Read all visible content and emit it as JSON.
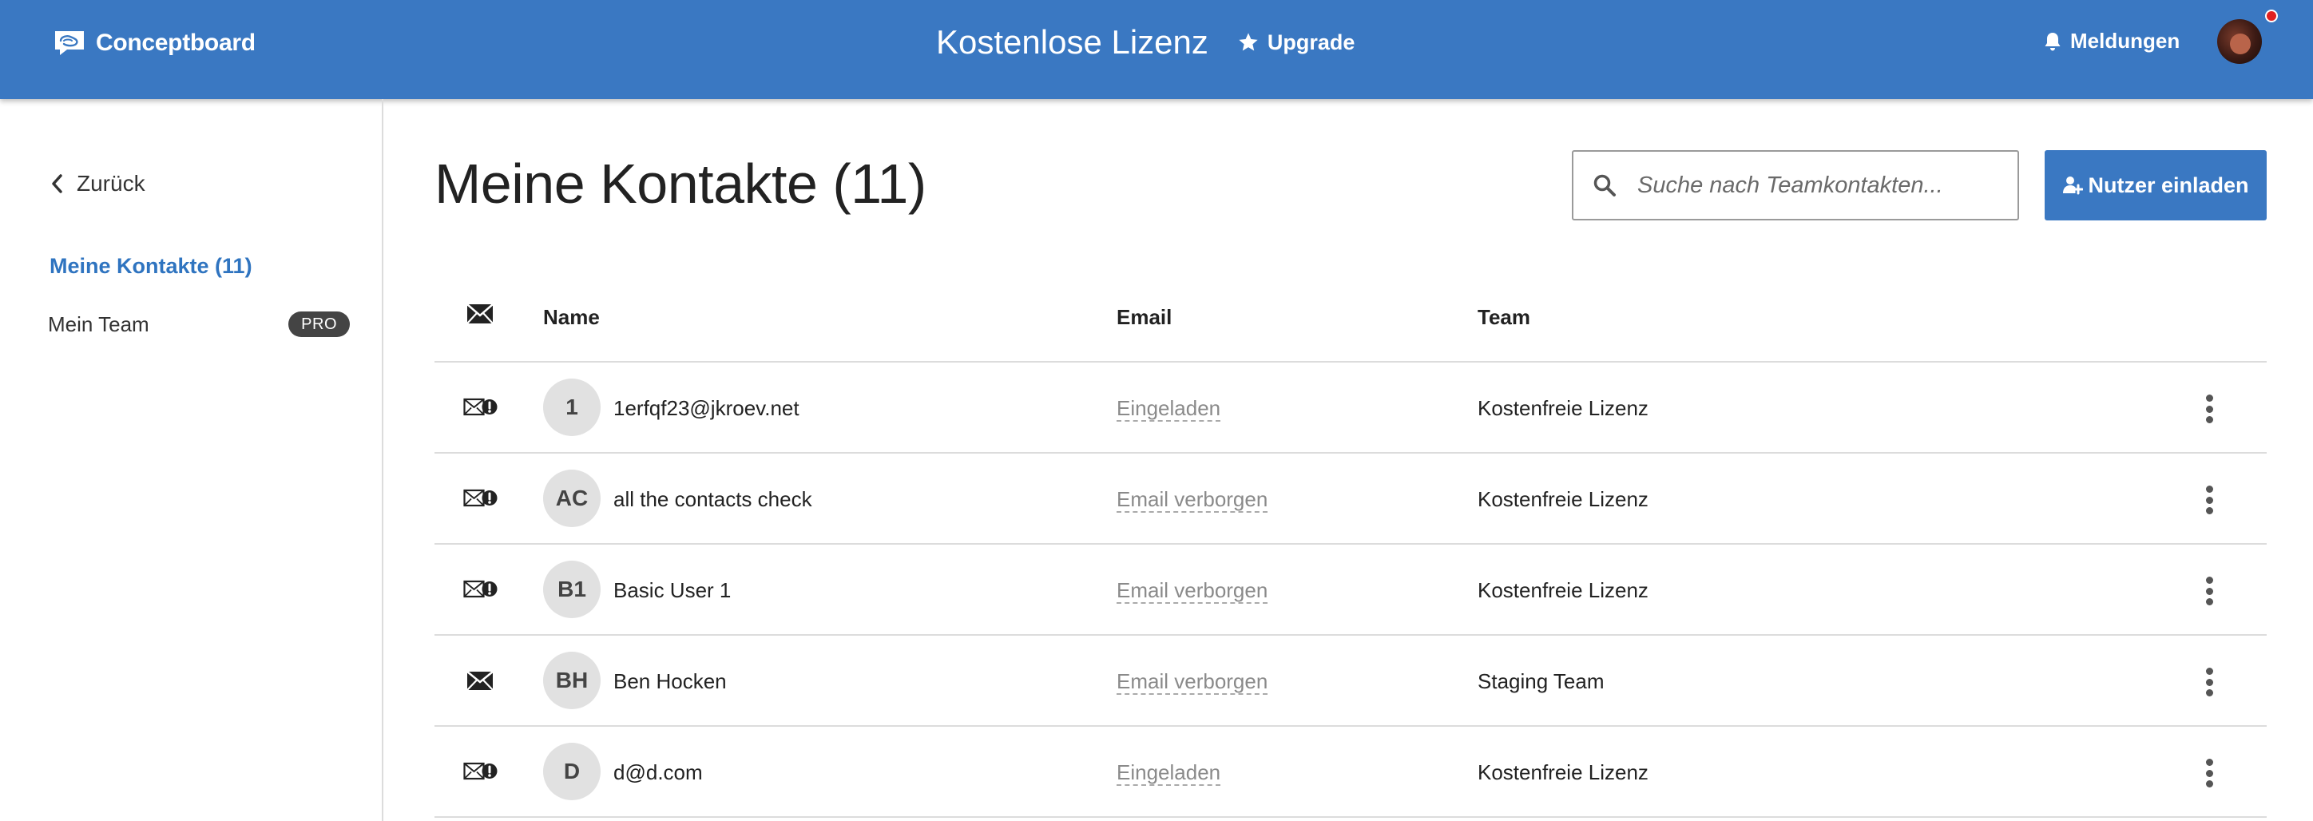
{
  "header": {
    "logo_text": "Conceptboard",
    "license_title": "Kostenlose Lizenz",
    "upgrade_label": "Upgrade",
    "notifications_label": "Meldungen",
    "accent_color": "#3a78c2"
  },
  "sidebar": {
    "back_label": "Zurück",
    "active_label": "Meine Kontakte (11)",
    "items": [
      {
        "label": "Mein Team",
        "badge": "PRO"
      }
    ]
  },
  "main": {
    "title": "Meine Kontakte (11)",
    "search": {
      "placeholder": "Suche nach Teamkontakten..."
    },
    "invite_label": "Nutzer einladen"
  },
  "table": {
    "headers": {
      "name": "Name",
      "email": "Email",
      "team": "Team"
    },
    "rows": [
      {
        "initials": "1",
        "name": "1erfqf23@jkroev.net",
        "email": "Eingeladen",
        "team": "Kostenfreie Lizenz",
        "mail_icon": "mail-alert-icon"
      },
      {
        "initials": "AC",
        "name": "all the contacts check",
        "email": "Email verborgen",
        "team": "Kostenfreie Lizenz",
        "mail_icon": "mail-alert-icon"
      },
      {
        "initials": "B1",
        "name": "Basic User 1",
        "email": "Email verborgen",
        "team": "Kostenfreie Lizenz",
        "mail_icon": "mail-alert-icon"
      },
      {
        "initials": "BH",
        "name": "Ben Hocken",
        "email": "Email verborgen",
        "team": "Staging Team",
        "mail_icon": "mail-icon"
      },
      {
        "initials": "D",
        "name": "d@d.com",
        "email": "Eingeladen",
        "team": "Kostenfreie Lizenz",
        "mail_icon": "mail-alert-icon"
      }
    ]
  }
}
